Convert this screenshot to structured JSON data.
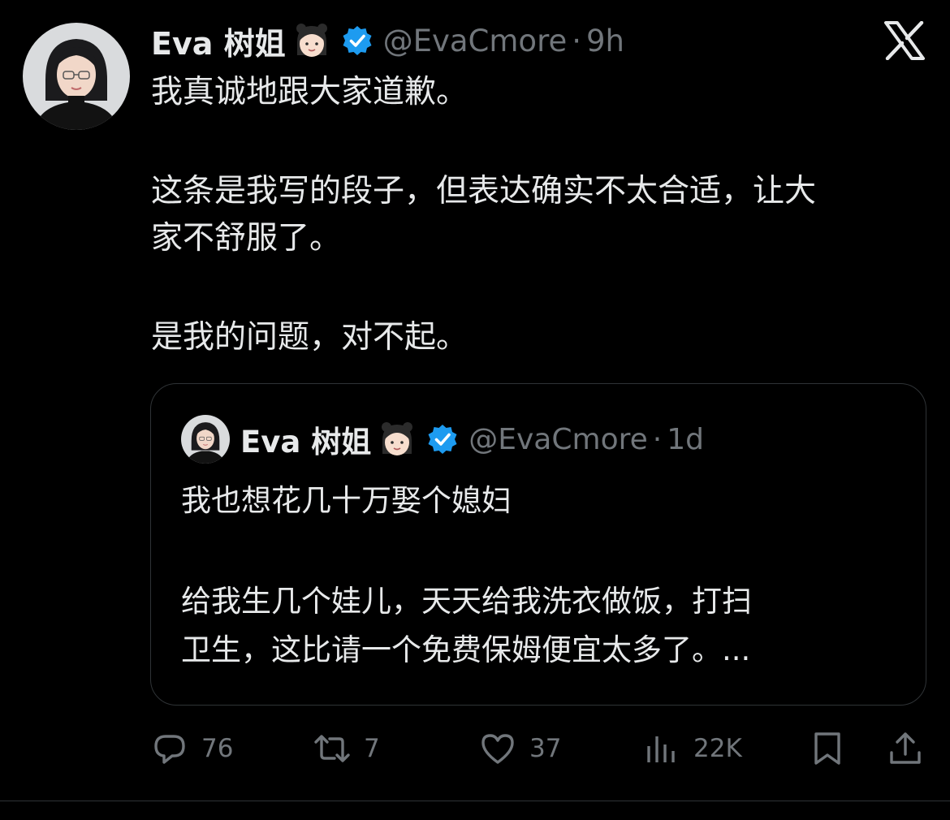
{
  "tweet": {
    "author_name": "Eva 树姐",
    "handle": "@EvaCmore",
    "separator": "·",
    "time": "9h",
    "verified": true,
    "text_lines": [
      "我真诚地跟大家道歉。",
      "这条是我写的段子，但表达确实不太合适，让大",
      "家不舒服了。",
      "是我的问题，对不起。"
    ]
  },
  "quoted_tweet": {
    "author_name": "Eva 树姐",
    "handle": "@EvaCmore",
    "separator": "·",
    "time": "1d",
    "verified": true,
    "text_lines": [
      "我也想花几十万娶个媳妇",
      "给我生几个娃儿，天天给我洗衣做饭，打扫",
      "卫生，这比请一个免费保姆便宜太多了。..."
    ]
  },
  "actions": {
    "replies": "76",
    "retweets": "7",
    "likes": "37",
    "views": "22K"
  },
  "icons": {
    "brand": "x-logo-icon",
    "verified": "verified-badge-icon",
    "emoji": "girl-emoji-icon",
    "reply": "reply-icon",
    "retweet": "retweet-icon",
    "like": "heart-icon",
    "views": "views-chart-icon",
    "bookmark": "bookmark-icon",
    "share": "share-icon"
  },
  "colors": {
    "background": "#000000",
    "text": "#e7e9ea",
    "muted": "#71767b",
    "border": "#2f3336",
    "verified_blue": "#1d9bf0"
  }
}
